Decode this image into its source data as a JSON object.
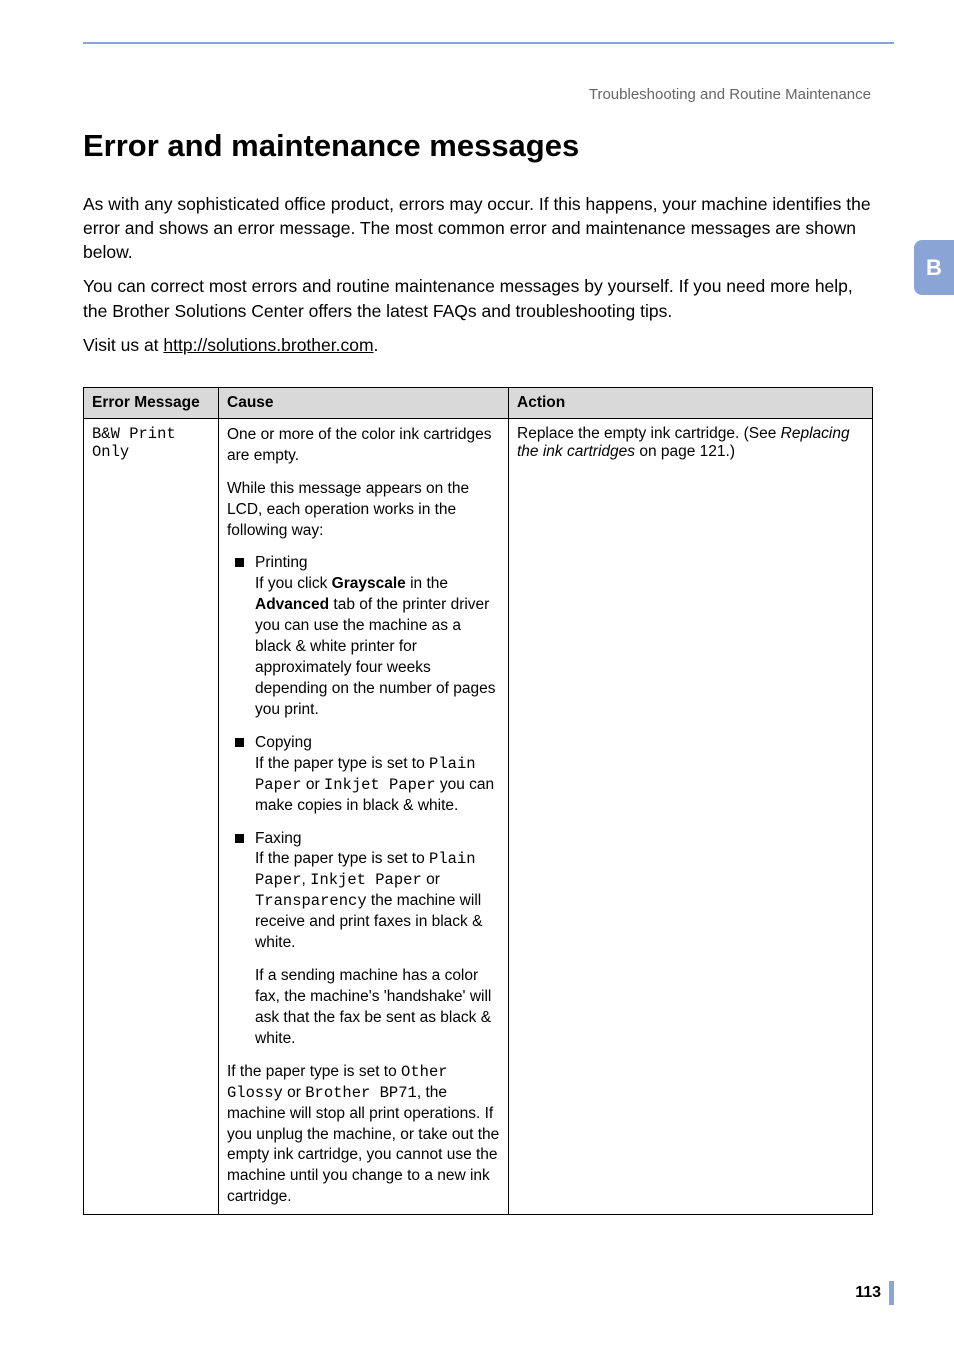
{
  "breadcrumb": "Troubleshooting and Routine Maintenance",
  "side_tab": "B",
  "heading": "Error and maintenance messages",
  "intro": {
    "p1": "As with any sophisticated office product, errors may occur. If this happens, your machine identifies the error and shows an error message. The most common error and maintenance messages are shown below.",
    "p2": "You can correct most errors and routine maintenance messages by yourself. If you need more help, the Brother Solutions Center offers the latest FAQs and troubleshooting tips.",
    "p3_prefix": "Visit us at ",
    "p3_link": "http://solutions.brother.com",
    "p3_suffix": "."
  },
  "table": {
    "headers": {
      "c1": "Error Message",
      "c2": "Cause",
      "c3": "Action"
    },
    "row": {
      "error_msg": "B&W Print Only",
      "cause": {
        "para1": "One or more of the color ink cartridges are empty.",
        "para2": "While this message appears on the LCD, each operation works in the following way:",
        "printing": {
          "head": "Printing",
          "t1": "If you click ",
          "b1": "Grayscale",
          "t2": " in the ",
          "b2": "Advanced",
          "t3": " tab of the printer driver you can use the machine as a black & white printer for approximately four weeks depending on the number of pages you print."
        },
        "copying": {
          "head": "Copying",
          "t1": "If the paper type is set to ",
          "m1": "Plain Paper",
          "t2": " or ",
          "m2": "Inkjet Paper",
          "t3": " you can make copies in black & white."
        },
        "faxing": {
          "head": "Faxing",
          "t1": "If the paper type is set to ",
          "m1": "Plain Paper",
          "t2": ", ",
          "m2": "Inkjet Paper",
          "t3": " or ",
          "m3": "Transparency",
          "t4": " the machine will receive and print faxes in black & white."
        },
        "para3": "If a sending machine has a color fax, the machine's 'handshake' will ask that the fax be sent as black & white.",
        "para4": {
          "t1": "If the paper type is set to ",
          "m1": "Other Glossy",
          "t2": " or ",
          "m2": "Brother BP71",
          "t3": ", the machine will stop all print operations. If you unplug the machine, or take out the empty ink cartridge, you cannot use the machine until you change to a new ink cartridge."
        }
      },
      "action": {
        "t1": "Replace the empty ink cartridge. (See ",
        "i1": "Replacing the ink cartridges",
        "t2": " on page 121.)"
      }
    }
  },
  "page_number": "113"
}
